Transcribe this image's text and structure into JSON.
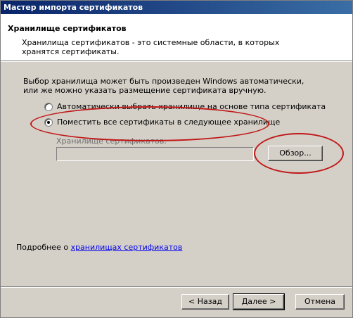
{
  "window": {
    "title": "Мастер импорта сертификатов"
  },
  "header": {
    "title": "Хранилище сертификатов",
    "description": "Хранилища сертификатов - это системные области, в которых хранятся сертификаты."
  },
  "body": {
    "intro": "Выбор хранилища может быть произведен Windows автоматически, или же можно указать размещение сертификата вручную.",
    "radio_auto": {
      "label": "Автоматически выбрать хранилище на основе типа сертификата",
      "checked": false
    },
    "radio_manual": {
      "label": "Поместить все сертификаты в следующее хранилище",
      "checked": true
    },
    "store_label": "Хранилище сертификатов:",
    "store_value": "",
    "browse_label": "Обзор...",
    "more_prefix": "Подробнее о ",
    "more_link": "хранилищах сертификатов"
  },
  "footer": {
    "back_label": "< Назад",
    "next_label": "Далее >",
    "cancel_label": "Отмена"
  },
  "annotations": {
    "highlight_color": "#c01818"
  }
}
